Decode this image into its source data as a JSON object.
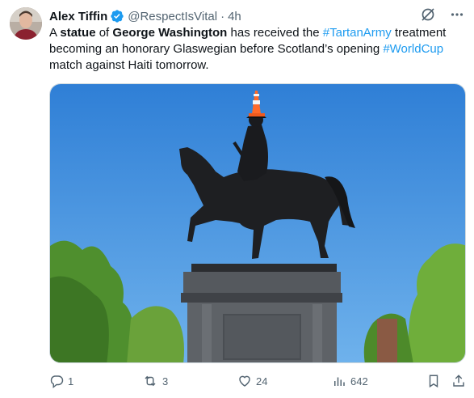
{
  "author": {
    "name": "Alex Tiffin",
    "handle": "@RespectIsVital",
    "separator": "·",
    "time": "4h"
  },
  "tweet": {
    "parts": [
      {
        "text": "A ",
        "style": "normal"
      },
      {
        "text": "statue",
        "style": "bold"
      },
      {
        "text": " of ",
        "style": "normal"
      },
      {
        "text": "George Washington",
        "style": "bold"
      },
      {
        "text": " has received the ",
        "style": "normal"
      },
      {
        "text": "#TartanArmy",
        "style": "hashtag"
      },
      {
        "text": " treatment becoming an honorary Glaswegian before Scotland’s opening ",
        "style": "normal"
      },
      {
        "text": "#WorldCup",
        "style": "hashtag"
      },
      {
        "text": " match against Haiti tomorrow.",
        "style": "normal"
      }
    ]
  },
  "actions": {
    "replies": "1",
    "reposts": "3",
    "likes": "24",
    "views": "642"
  },
  "colors": {
    "accent": "#1d9bf0",
    "secondary_text": "#536471",
    "sky": "#3f8fdc"
  },
  "icons": [
    "verified-badge-icon",
    "grok-icon",
    "more-icon",
    "reply-icon",
    "repost-icon",
    "like-icon",
    "views-icon",
    "bookmark-icon",
    "share-icon"
  ]
}
